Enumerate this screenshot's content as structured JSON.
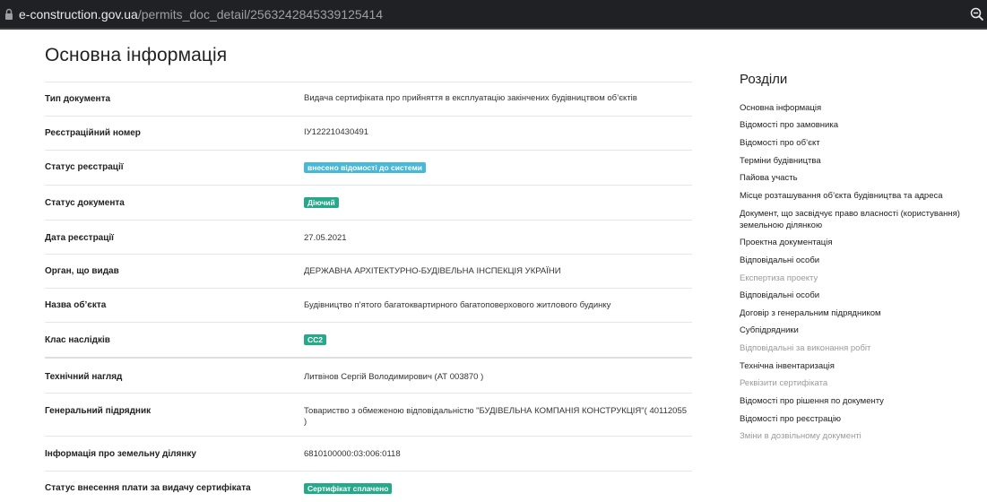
{
  "browser": {
    "url_host": "e-construction.gov.ua",
    "url_path": "/permits_doc_detail/2563242845339125414"
  },
  "main": {
    "title": "Основна інформація",
    "rows": [
      {
        "label": "Тип документа",
        "value": "Видача сертифіката про прийняття в експлуатацію закінчених будівництвом об’єктів"
      },
      {
        "label": "Реєстраційний номер",
        "value": "IУ122210430491"
      },
      {
        "label": "Статус реєстрації",
        "badge": "внесено відомості до системи",
        "badge_color": "#47b8d8"
      },
      {
        "label": "Статус документа",
        "badge": "Діючий",
        "badge_color": "#26a98a"
      },
      {
        "label": "Дата реєстрації",
        "value": "27.05.2021"
      },
      {
        "label": "Орган, що видав",
        "value": "ДЕРЖАВНА АРХІТЕКТУРНО-БУДІВЕЛЬНА ІНСПЕКЦІЯ УКРАЇНИ"
      },
      {
        "label": "Назва об’єкта",
        "value": "Будівництво п’ятого багатоквартирного багатоповерхового житлового будинку"
      },
      {
        "label": "Клас наслідків",
        "badge": "СС2",
        "badge_color": "#26a98a"
      },
      {
        "label": "Технічний нагляд",
        "value": "Литвінов Сергій Володимирович (АТ 003870 )"
      },
      {
        "label": "Генеральний підрядник",
        "value": "Товариство з обмеженою відповідальністю \"БУДІВЕЛЬНА КОМПАНІЯ КОНСТРУКЦІЯ\"( 40112055 )"
      },
      {
        "label": "Інформація про земельну ділянку",
        "value": "6810100000:03:006:0118"
      },
      {
        "label": "Статус внесення плати за видачу сертифіката",
        "badge": "Сертифікат сплачено",
        "badge_color": "#26a98a"
      }
    ]
  },
  "sections": {
    "title": "Розділи",
    "items": [
      {
        "label": "Основна інформація",
        "enabled": true
      },
      {
        "label": "Відомості про замовника",
        "enabled": true
      },
      {
        "label": "Відомості про об’єкт",
        "enabled": true
      },
      {
        "label": "Терміни будівництва",
        "enabled": true
      },
      {
        "label": "Пайова участь",
        "enabled": true
      },
      {
        "label": "Місце розташування об’єкта будівництва та адреса",
        "enabled": true
      },
      {
        "label": "Документ, що засвідчує право власності (користування) земельною ділянкою",
        "enabled": true
      },
      {
        "label": "Проектна документація",
        "enabled": true
      },
      {
        "label": "Відповідальні особи",
        "enabled": true
      },
      {
        "label": "Експертиза проекту",
        "enabled": false
      },
      {
        "label": "Відповідальні особи",
        "enabled": true
      },
      {
        "label": "Договір з генеральним підрядником",
        "enabled": true
      },
      {
        "label": "Субпідрядники",
        "enabled": true
      },
      {
        "label": "Відповідальні за виконання робіт",
        "enabled": false
      },
      {
        "label": "Технічна інвентаризація",
        "enabled": true
      },
      {
        "label": "Реквізити сертифіката",
        "enabled": false
      },
      {
        "label": "Відомості про рішення по документу",
        "enabled": true
      },
      {
        "label": "Відомості про реєстрацію",
        "enabled": true
      },
      {
        "label": "Зміни в дозвільному документі",
        "enabled": false
      }
    ]
  }
}
